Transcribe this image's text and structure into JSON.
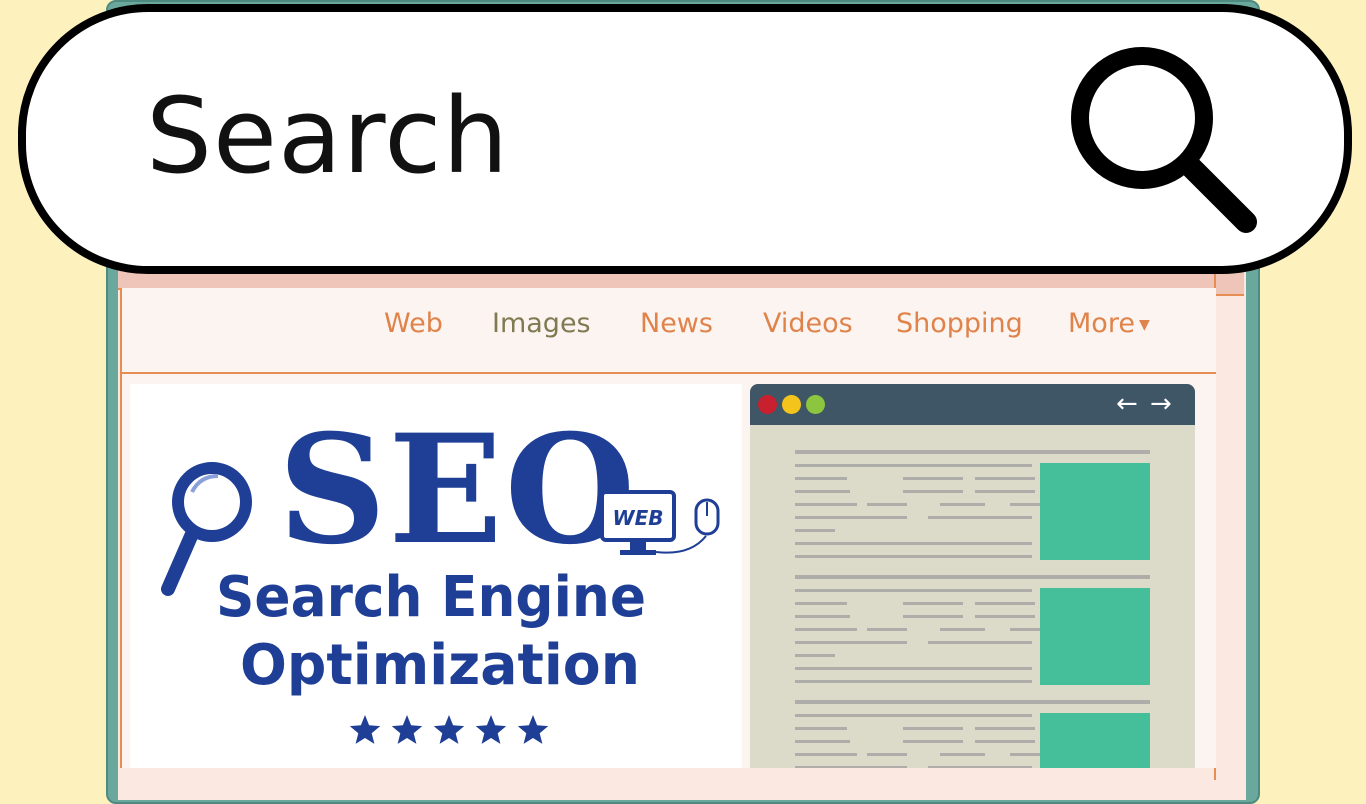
{
  "search": {
    "label": "Search"
  },
  "nav": {
    "items": [
      {
        "label": "Web"
      },
      {
        "label": "Images"
      },
      {
        "label": "News"
      },
      {
        "label": "Videos"
      },
      {
        "label": "Shopping"
      },
      {
        "label": "More"
      }
    ]
  },
  "seo": {
    "title": "SEO",
    "line1": "Search Engine",
    "line2": "Optimization",
    "monitor_label": "WEB",
    "stars": 5
  },
  "icons": {
    "search": "search-icon",
    "more_caret": "caret-down-icon",
    "back": "arrow-left-icon",
    "forward": "arrow-right-icon"
  },
  "colors": {
    "background": "#fdf1be",
    "nav_orange": "#e0834b",
    "nav_olive": "#7f7a52",
    "seo_blue": "#1f3f96",
    "thumb_green": "#45be9a",
    "window_bar": "#3e5666",
    "dot_red": "#c8202f",
    "dot_yellow": "#f3c51c",
    "dot_green": "#8cc63f"
  }
}
